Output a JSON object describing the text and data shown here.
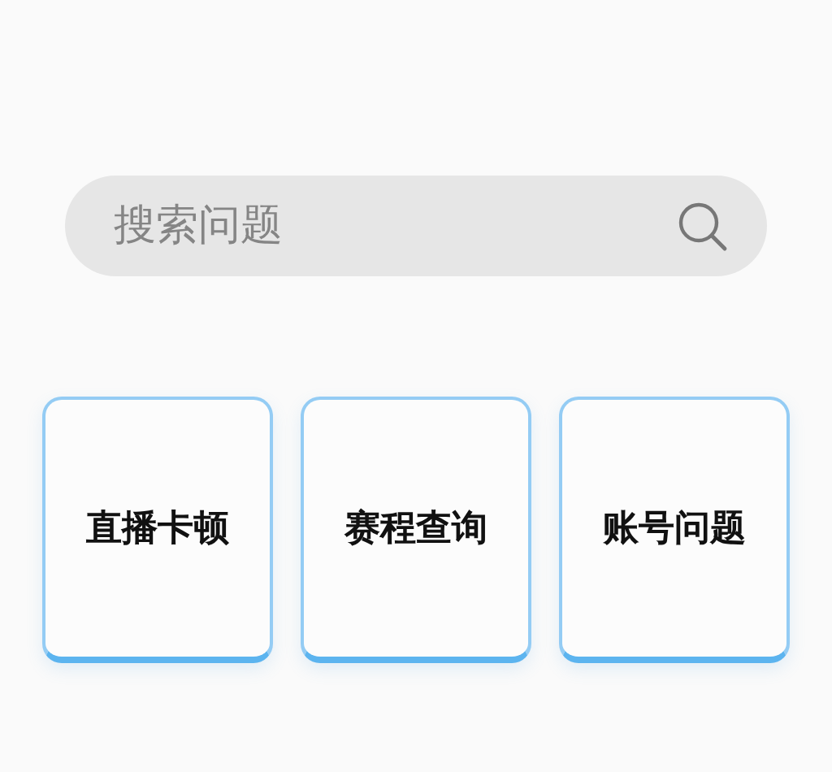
{
  "search": {
    "placeholder": "搜索问题"
  },
  "categories": [
    {
      "label": "直播卡顿"
    },
    {
      "label": "赛程查询"
    },
    {
      "label": "账号问题"
    }
  ]
}
